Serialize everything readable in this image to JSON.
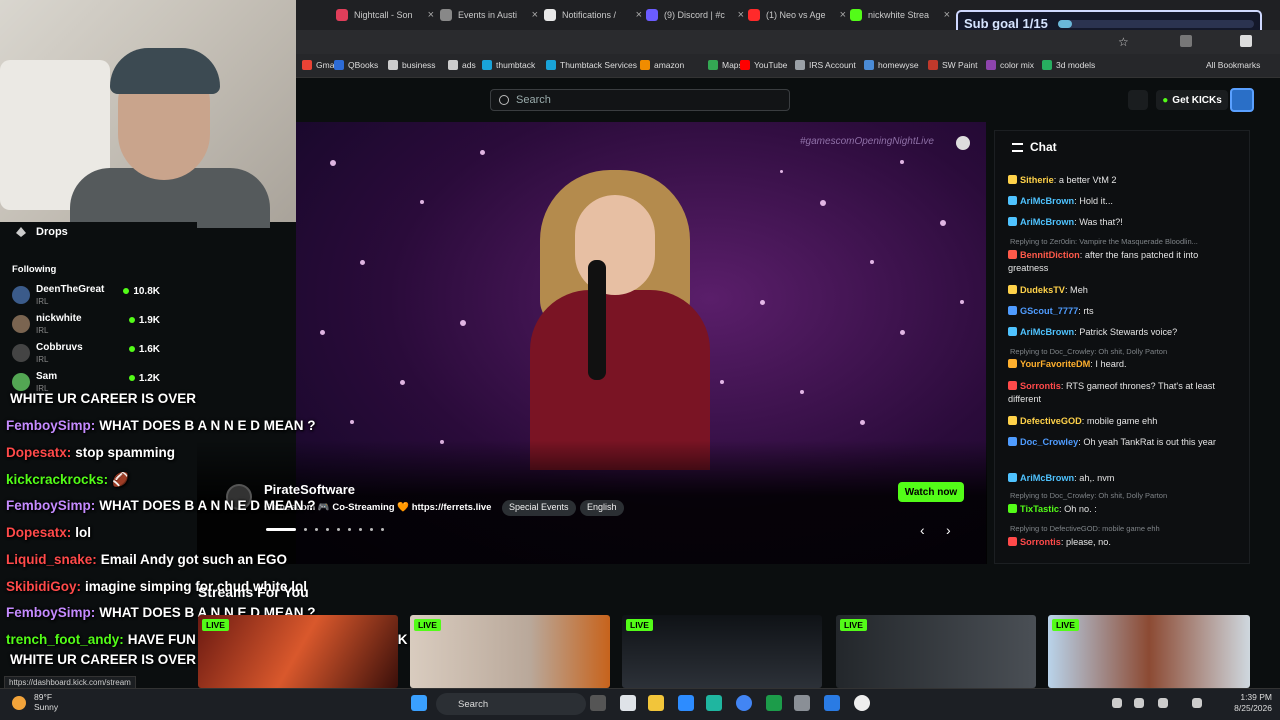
{
  "browser": {
    "tabs": [
      {
        "label": "Nightcall - Son",
        "color": "#e03e5a"
      },
      {
        "label": "Events in Austi",
        "color": "#888888"
      },
      {
        "label": "Notifications /",
        "color": "#e8e8e8"
      },
      {
        "label": "(9) Discord | #c",
        "color": "#6b5cff"
      },
      {
        "label": "(1) Neo vs Age",
        "color": "#ff2a2a"
      },
      {
        "label": "nickwhite Strea",
        "color": "#53fc18"
      }
    ],
    "bookmarks": [
      {
        "label": "Gmail",
        "color": "#ea4335"
      },
      {
        "label": "QBooks",
        "color": "#2d6bd6"
      },
      {
        "label": "business",
        "color": "#cccccc"
      },
      {
        "label": "ads",
        "color": "#cccccc"
      },
      {
        "label": "thumbtack",
        "color": "#19a3d8"
      },
      {
        "label": "Thumbtack Services",
        "color": "#19a3d8"
      },
      {
        "label": "amazon",
        "color": "#f08c00"
      },
      {
        "label": "Maps",
        "color": "#34a853"
      },
      {
        "label": "YouTube",
        "color": "#ff0000"
      },
      {
        "label": "IRS Account",
        "color": "#9aa0a6"
      },
      {
        "label": "homewyse",
        "color": "#4a8bd6"
      },
      {
        "label": "SW Paint",
        "color": "#c0392b"
      },
      {
        "label": "color mix",
        "color": "#8e44ad"
      },
      {
        "label": "3d models",
        "color": "#27ae60"
      }
    ],
    "all_bookmarks": "All Bookmarks"
  },
  "subgoal": {
    "label": "Sub goal 1/15",
    "progress": 0.07
  },
  "header": {
    "search_placeholder": "Search",
    "get_kicks": "Get KICKs"
  },
  "sidebar": {
    "drops": "Drops",
    "following_label": "Following",
    "following": [
      {
        "name": "DeenTheGreat",
        "category": "IRL",
        "viewers": "10.8K",
        "avatar": "#3b5b8a"
      },
      {
        "name": "nickwhite",
        "category": "IRL",
        "viewers": "1.9K",
        "avatar": "#7a6450"
      },
      {
        "name": "Cobbruvs",
        "category": "IRL",
        "viewers": "1.6K",
        "avatar": "#444444"
      },
      {
        "name": "Sam",
        "category": "IRL",
        "viewers": "1.2K",
        "avatar": "#53a653"
      }
    ]
  },
  "player": {
    "hashtag": "#gamescomOpeningNightLive",
    "streamer": "PirateSoftware",
    "title": "Gamescom 🎮 Co-Streaming 🧡 https://ferrets.live",
    "tags": [
      "Special Events",
      "English"
    ],
    "watch_now": "Watch now"
  },
  "chat": {
    "title": "Chat",
    "messages": [
      {
        "user": "Sitherie",
        "color": "#ffd24a",
        "text": "a better VtM 2"
      },
      {
        "user": "AriMcBrown",
        "color": "#4fc3ff",
        "text": "Hold it..."
      },
      {
        "user": "AriMcBrown",
        "color": "#4fc3ff",
        "text": "Was that?!"
      },
      {
        "reply": "Replying to Zer0din: Vampire the Masquerade Bloodlin..."
      },
      {
        "user": "BennitDiction",
        "color": "#ff5a4a",
        "text": "after the fans patched it into greatness"
      },
      {
        "user": "DudeksTV",
        "color": "#ffd24a",
        "text": "Meh"
      },
      {
        "user": "GScout_7777",
        "color": "#4f9cff",
        "text": "rts"
      },
      {
        "user": "AriMcBrown",
        "color": "#4fc3ff",
        "text": "Patrick Stewards voice?"
      },
      {
        "reply": "Replying to Doc_Crowley: Oh shit, Dolly Parton"
      },
      {
        "user": "YourFavoriteDM",
        "color": "#ffb02e",
        "text": "I heard."
      },
      {
        "user": "Sorrontis",
        "color": "#ff4a4a",
        "text": "RTS gameof thrones? That's at least different"
      },
      {
        "user": "DefectiveGOD",
        "color": "#ffd24a",
        "text": "mobile game ehh"
      },
      {
        "user": "Doc_Crowley",
        "color": "#4f9cff",
        "text": "Oh yeah TankRat is out this year"
      },
      {
        "user": "AriMcBrown",
        "color": "#4fc3ff",
        "text": "ah,. nvm"
      },
      {
        "reply": "Replying to Doc_Crowley: Oh shit, Dolly Parton"
      },
      {
        "user": "TixTastic",
        "color": "#53fc18",
        "text": "Oh no. :"
      },
      {
        "reply": "Replying to DefectiveGOD: mobile game ehh"
      },
      {
        "user": "Sorrontis",
        "color": "#ff4a4a",
        "text": "please, no."
      }
    ]
  },
  "overlay_chat": [
    {
      "user": "",
      "text": "WHITE UR CAREER IS OVER",
      "color": "#ffffff"
    },
    {
      "user": "FemboySimp:",
      "text": "WHAT DOES B A N N E D MEAN ?",
      "color": "#c58bff"
    },
    {
      "user": "Dopesatx:",
      "text": "stop spamming",
      "color": "#ff4a4a"
    },
    {
      "user": "kickcrackrocks:",
      "text": "🏈",
      "color": "#53fc18"
    },
    {
      "user": "FemboySimp:",
      "text": "WHAT DOES B A N N E D MEAN ?",
      "color": "#c58bff"
    },
    {
      "user": "Dopesatx:",
      "text": "lol",
      "color": "#ff4a4a"
    },
    {
      "user": "Liquid_snake:",
      "text": "Email Andy got such an EGO",
      "color": "#ff4a4a"
    },
    {
      "user": "SkibidiGoy:",
      "text": "imagine simping for chud white lol",
      "color": "#ff4a4a"
    },
    {
      "user": "FemboySimp:",
      "text": "WHAT DOES B A N N E D MEAN ?",
      "color": "#c58bff"
    },
    {
      "user": "trench_foot_andy:",
      "text": "HAVE FUN WITH JAGERROB AND NO NICK",
      "color": "#53fc18"
    },
    {
      "user": "",
      "text": "WHITE UR CAREER IS OVER",
      "color": "#ffffff"
    }
  ],
  "streams": {
    "heading": "Streams For You",
    "live_label": "LIVE"
  },
  "status_url": "https://dashboard.kick.com/stream",
  "taskbar": {
    "search": "Search",
    "weather_temp": "89°F",
    "weather_desc": "Sunny",
    "time": "1:39 PM",
    "date": "8/25/2026"
  }
}
